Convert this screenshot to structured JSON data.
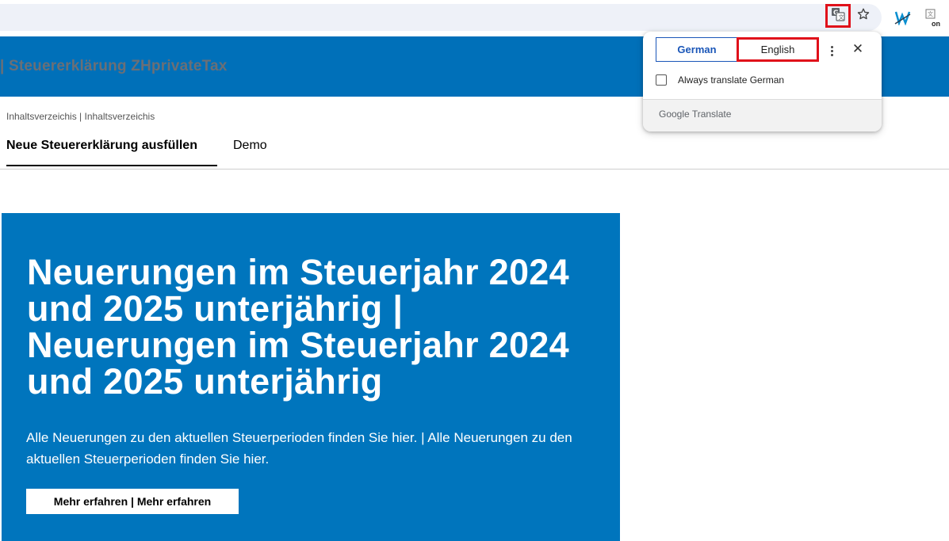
{
  "browser": {
    "translate_icon": "translate-icon",
    "star_icon": "star-icon",
    "extension1_label": "W",
    "extension2_label": "on"
  },
  "site": {
    "title": "| Steuererklärung ZHprivateTax",
    "breadcrumb": "Inhaltsverzeichis | Inhaltsverzeichis",
    "tabs": [
      {
        "label": "Neue Steuererklärung ausfüllen",
        "active": true
      },
      {
        "label": "Demo",
        "active": false
      }
    ]
  },
  "hero": {
    "title": "Neuerungen im Steuerjahr 2024 und 2025 unterjährig | Neuerungen im Steuerjahr 2024 und 2025 unterjährig",
    "text": "Alle Neuerungen zu den aktuellen Steuerperioden finden Sie hier. | Alle Neuerungen zu den aktuellen Steuerperioden finden Sie hier.",
    "button_label": "Mehr erfahren | Mehr erfahren"
  },
  "translate_popup": {
    "source_language": "German",
    "target_language": "English",
    "always_translate_label": "Always translate German",
    "always_translate_checked": false,
    "footer_brand": "Google",
    "footer_product": "Translate"
  },
  "colors": {
    "site_blue": "#0070b9",
    "hero_blue": "#0075bd",
    "highlight_red": "#e0101a",
    "google_blue": "#1a56b8"
  }
}
